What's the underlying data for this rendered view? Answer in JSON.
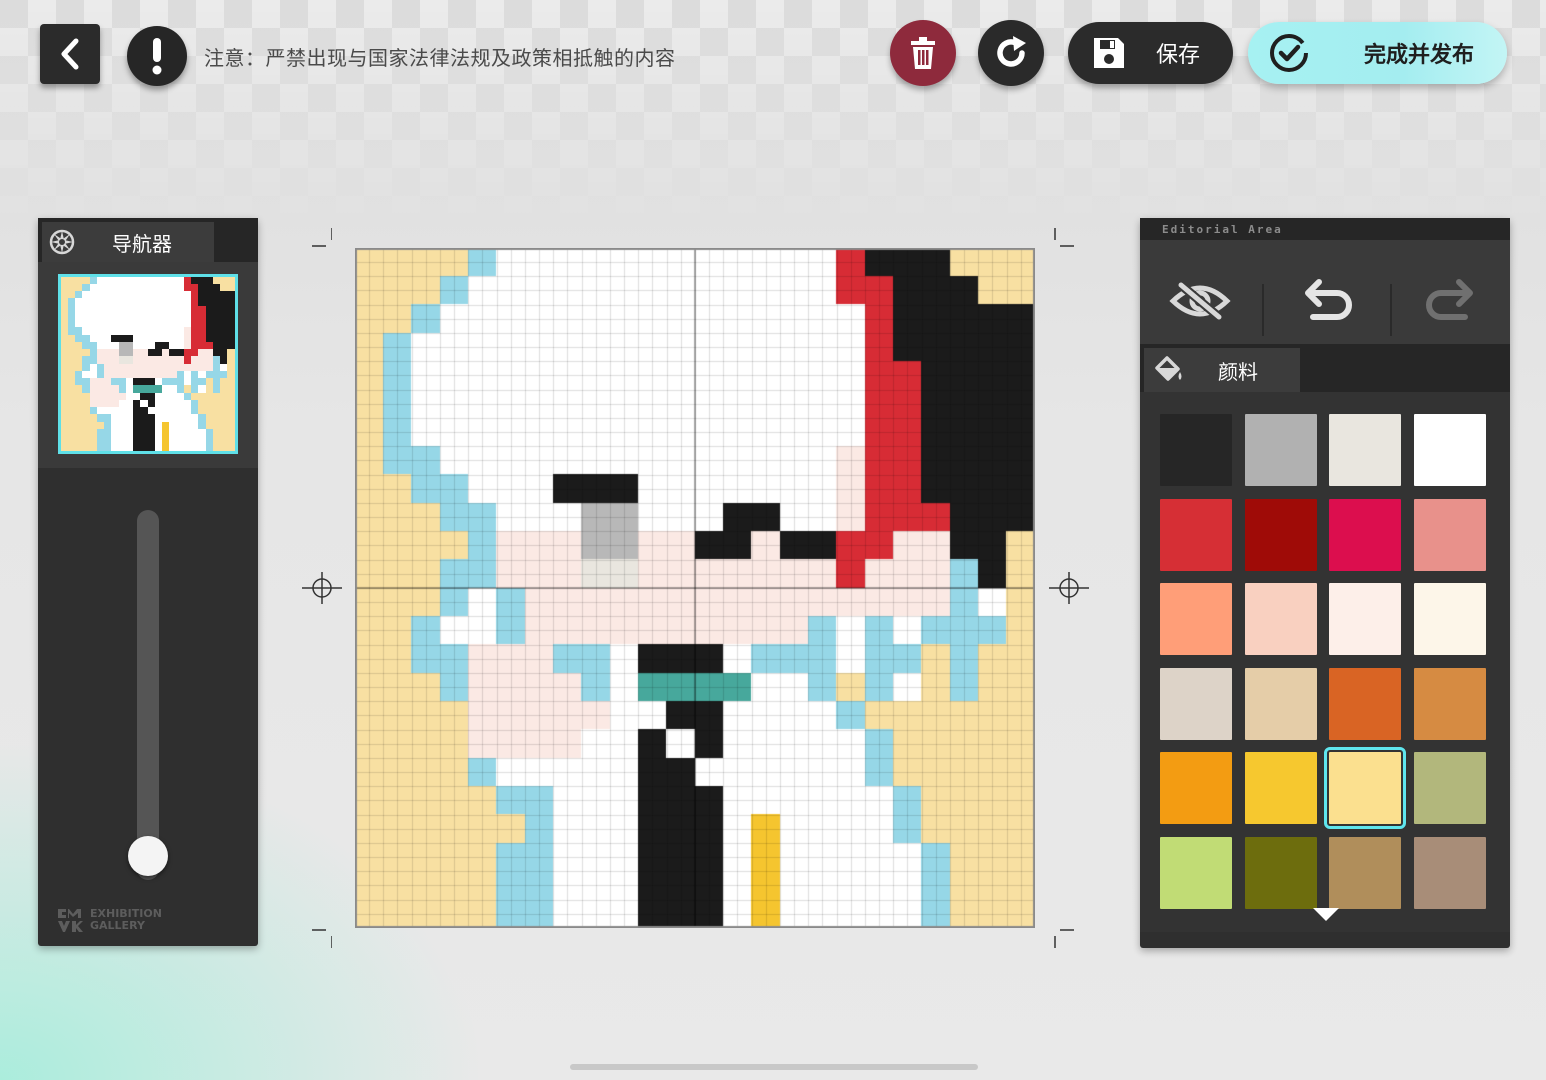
{
  "header": {
    "notice": "注意：严禁出现与国家法律法规及政策相抵触的内容",
    "save_label": "保存",
    "publish_label": "完成并发布"
  },
  "navigator": {
    "tab_label": "导航器",
    "zoom_level": 0.07,
    "logo_line1": "EXHIBITION",
    "logo_line2": "GALLERY"
  },
  "editor": {
    "area_title": "Editorial Area",
    "pigment_tab_label": "颜料",
    "selected_swatch": 18,
    "swatches": [
      "#262626",
      "#b1b1b1",
      "#e9e6df",
      "#ffffff",
      "#d62f35",
      "#9f0b07",
      "#dc0e4e",
      "#e8918b",
      "#ff9e78",
      "#f9d0c0",
      "#fdefe9",
      "#fdf6e9",
      "#ddd3c8",
      "#e5cda8",
      "#d96424",
      "#d68b42",
      "#f39c12",
      "#f6c82f",
      "#fbe08f",
      "#b2b77c",
      "#c1dc75",
      "#6d6d0d",
      "#b08e5b",
      "#a88d78"
    ]
  },
  "artwork": {
    "grid_size": 24,
    "palette": {
      "Y": "#f8e0a2",
      "B": "#96d7e7",
      "W": "#ffffff",
      "R": "#d72c35",
      "K": "#1b1b1b",
      "S": "#fbe9e4",
      "G": "#b8b8b8",
      "E": "#e9e6df",
      "T": "#47a89c",
      "O": "#f5c52f"
    },
    "rows": [
      "YYYYBWWWWWWWWWWWWRKKKYYY",
      "YYYBWWWWWWWWWWWWWRRKKKYY",
      "YYBWWWWWWWWWWWWWWWRKKKKK",
      "YBWWWWWWWWWWWWWWWWRKKKKK",
      "YBWWWWWWWWWWWWWWWWRRKKKK",
      "YBWWWWWWWWWWWWWWWWRRKKKK",
      "YBWWWWWWWWWWWWWWWWRRKKKK",
      "YBBWWWWWWWWWWWWWWSRRKKKK",
      "YYBBWWWKKKWWWWWWWSRRKKKK",
      "YYYBBWWWGGWWWKKWWSRRRKKK",
      "YYYYBSSSGGSSKKSKKRRSSKKY",
      "YYYBBSSSEESSSSSSSRSSSBKY",
      "YYYBWBSSSSSSSSSSSSSSSBWY",
      "YYBWWBSSSSSSSSSSBWBWBBBY",
      "YYBBSSSBBWKKKWBBBWBBYBYY",
      "YYYBSSSSBWTTTTWWBYBWYBYY",
      "YYYYSSSSSWWKKWWWWBYYYYYY",
      "YYYYSSSSWWKWKWWWWWBYYYYY",
      "YYYYBWWWWWKKWWWWWWBYYYYY",
      "YYYYYBBWWWKKKWWWWWWBYYYY",
      "YYYYYYBWWWKKKWOWWWWBYYYY",
      "YYYYYBBWWWKKKWOWWWWWBYYY"
    ],
    "rows_tail": [
      "YYYYYBBWWWKKKWOWWWWWBYYY",
      "YYYYYBBWWWKKKWOWWWWWBYYY"
    ]
  }
}
